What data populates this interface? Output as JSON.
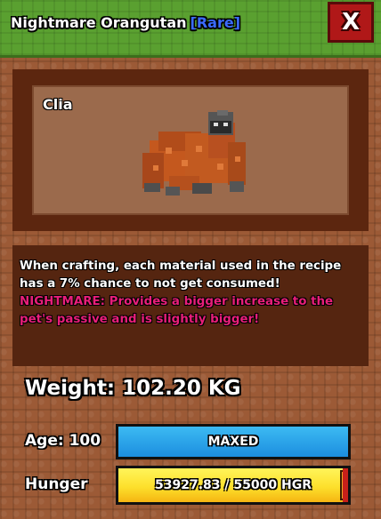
{
  "header": {
    "pet_title": "Nightmare Orangutan",
    "rarity_label": "[Rare]",
    "close_label": "X",
    "rarity_color": "#3b6bff"
  },
  "pet": {
    "name": "Clia",
    "model_icon": "orangutan-pet-model"
  },
  "description": {
    "text": "When crafting, each material used in the recipe has a 7% chance to not get consumed!",
    "nightmare_text": "NIGHTMARE: Provides a bigger increase to the pet's passive and is slightly bigger!",
    "nightmare_color": "#e81e7a"
  },
  "stats": {
    "weight_text": "Weight: 102.20 KG",
    "age_label": "Age: 100",
    "age_bar_text": "MAXED",
    "age_fill_fraction": 1.0,
    "hunger_label": "Hunger",
    "hunger_text": "53927.83 / 55000 HGR",
    "hunger_current": 53927.83,
    "hunger_max": 55000
  }
}
